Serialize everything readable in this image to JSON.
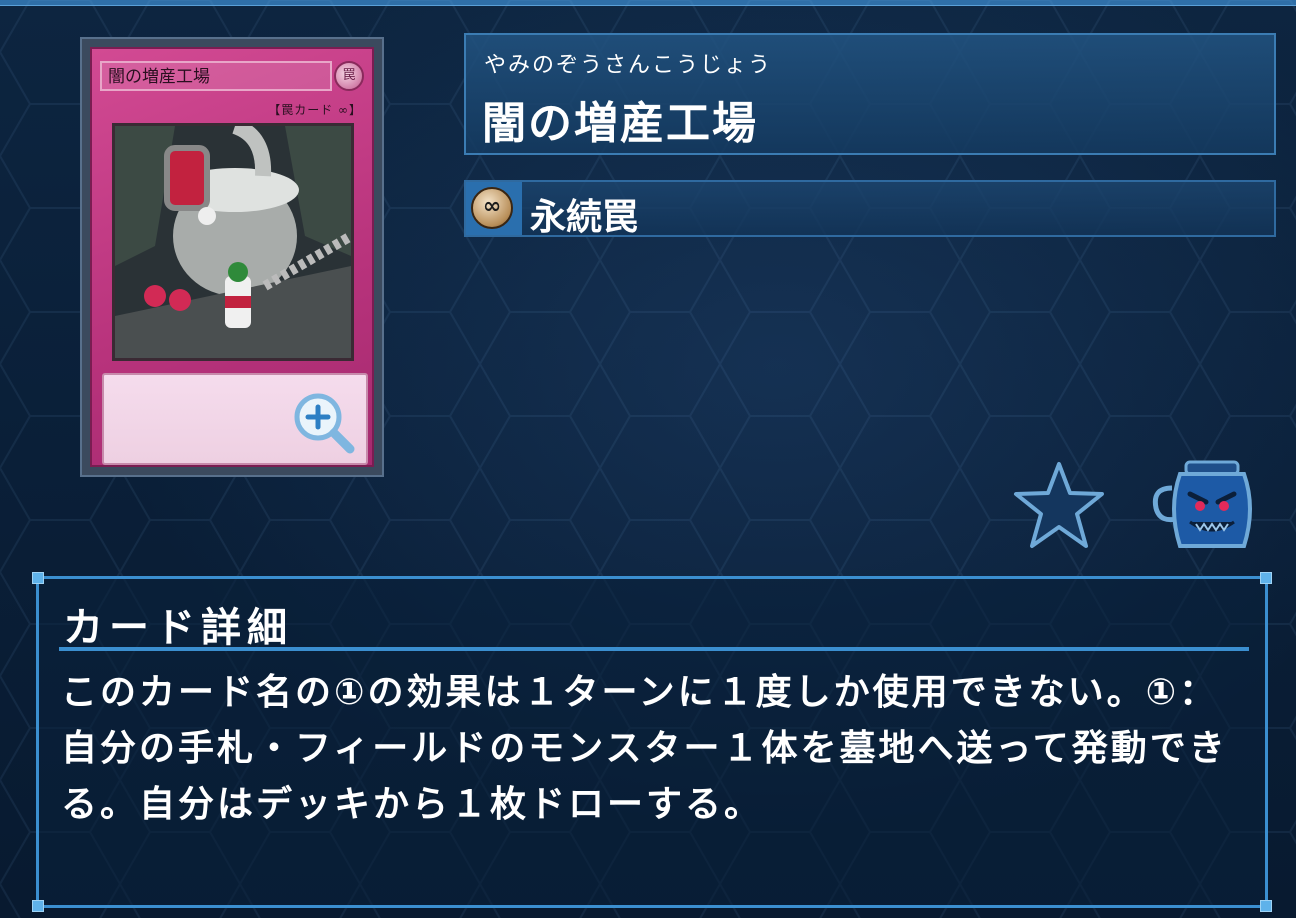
{
  "card_image": {
    "name": "闇の増産工場",
    "attribute_symbol": "罠",
    "type_line": "【罠カード ∞】"
  },
  "card_info": {
    "furigana": "やみのぞうさんこうじょう",
    "name": "闇の増産工場",
    "type_icon": "∞",
    "type": "永続罠"
  },
  "actions": {
    "favorite_icon": "star-icon",
    "collection_icon": "pot-icon"
  },
  "detail": {
    "heading": "カード詳細",
    "text": "このカード名の①の効果は１ターンに１度しか使用できない。①：自分の手札・フィールドのモンスター１体を墓地へ送って発動できる。自分はデッキから１枚ドローする。"
  },
  "colors": {
    "panel_border": "#3b8fd0",
    "trap_card": "#c23d87"
  }
}
